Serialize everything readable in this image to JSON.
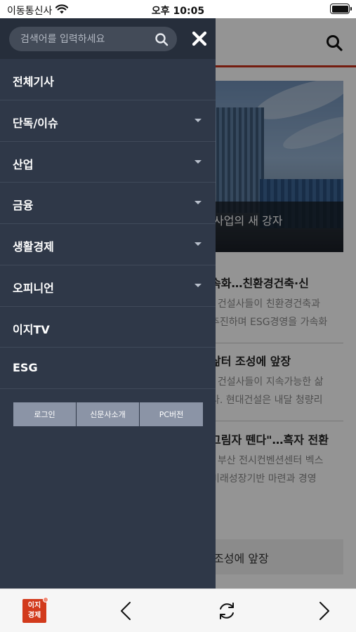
{
  "status_bar": {
    "carrier": "이동통신사",
    "time": "오후 10:05",
    "wifi_icon": "wifi-icon",
    "battery_icon": "battery-icon"
  },
  "drawer": {
    "search": {
      "placeholder": "검색어를 입력하세요",
      "value": ""
    },
    "close_icon": "close-icon",
    "menu": [
      {
        "label": "전체기사",
        "has_submenu": false
      },
      {
        "label": "단독/이슈",
        "has_submenu": true
      },
      {
        "label": "산업",
        "has_submenu": true
      },
      {
        "label": "금융",
        "has_submenu": true
      },
      {
        "label": "생활경제",
        "has_submenu": true
      },
      {
        "label": "오피니언",
        "has_submenu": true
      },
      {
        "label": "이지TV",
        "has_submenu": false
      },
      {
        "label": "ESG",
        "has_submenu": false
      }
    ],
    "buttons": [
      "로그인",
      "신문사소개",
      "PC버전"
    ]
  },
  "background_page": {
    "hero_caption": "사업의 새 강자",
    "articles": [
      {
        "title": "속화…친환경건축·신",
        "desc": [
          "] 건설사들이 친환경건축과",
          "추진하며 ESG경영을 가속화"
        ]
      },
      {
        "title": "삶터 조성에 앞장",
        "desc": [
          "] 건설사들이 지속가능한 삶",
          "다. 현대건설은 내달 청량리"
        ]
      },
      {
        "title": "그림자 뗀다\"…흑자 전환",
        "desc": [
          "] 부산 전시컨벤션센터 벡스",
          "미래성장기반 마련과 경영"
        ]
      }
    ],
    "box_text": "조성에 앞장"
  },
  "toolbar": {
    "logo": {
      "line1": "이지",
      "line2": "경제"
    },
    "back_icon": "chevron-left-icon",
    "reload_icon": "reload-icon",
    "forward_icon": "chevron-right-icon"
  },
  "colors": {
    "drawer_bg": "#2f3848",
    "accent": "#c8311b",
    "logo_red": "#d23a1c"
  }
}
